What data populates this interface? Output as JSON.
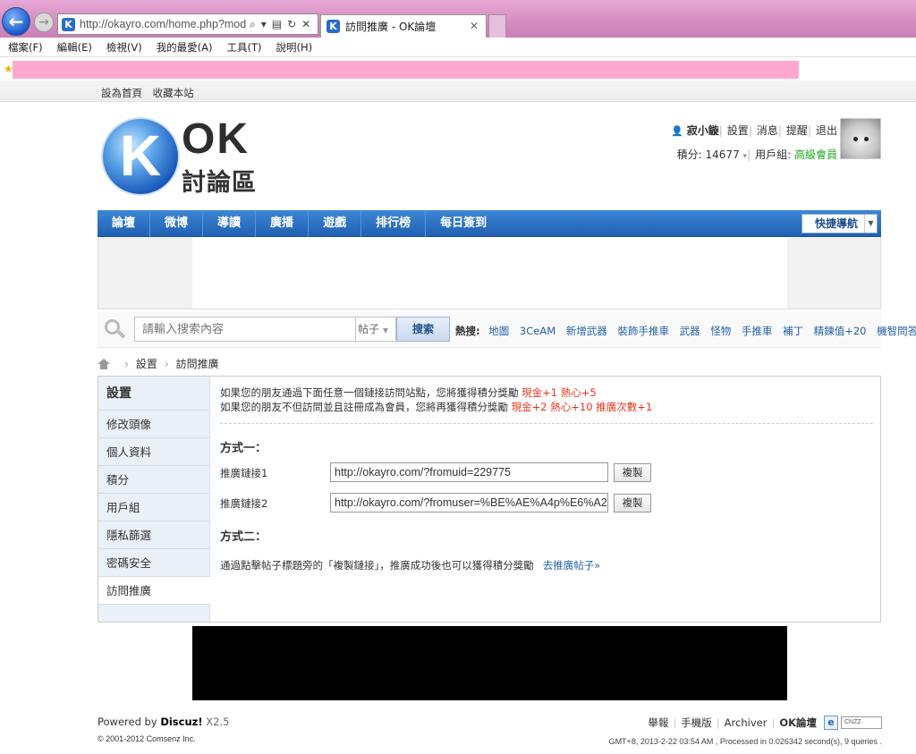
{
  "browser": {
    "url": "http://okayro.com/home.php?mod",
    "tab_title": "訪問推廣 - OK論壇",
    "favicon_letter": "K",
    "menu": [
      "檔案(F)",
      "編輯(E)",
      "檢視(V)",
      "我的最愛(A)",
      "工具(T)",
      "說明(H)"
    ]
  },
  "topbar": {
    "set_home": "設為首頁",
    "bookmark": "收藏本站"
  },
  "logo": {
    "letter": "K",
    "ok": "OK",
    "subtitle": "討論區"
  },
  "user": {
    "name": "寂小鏇",
    "links": [
      "設置",
      "消息",
      "提醒",
      "退出"
    ],
    "credits_label": "積分: 14677",
    "group_label": "用戶組: ",
    "group_value": "高級會員"
  },
  "nav": {
    "items": [
      "論壇",
      "微博",
      "導讀",
      "廣播",
      "遊戲",
      "排行榜",
      "每日簽到"
    ],
    "quick_nav": "快捷導航"
  },
  "search": {
    "placeholder": "請輸入搜索內容",
    "type": "帖子",
    "button": "搜索",
    "hot_label": "熱搜:",
    "hot_words": [
      "地圖",
      "3CeAM",
      "新增武器",
      "裝飾手推車",
      "武器",
      "怪物",
      "手推車",
      "補丁",
      "精鍊值+20",
      "機智問答"
    ]
  },
  "breadcrumb": {
    "settings": "設置",
    "current": "訪問推廣"
  },
  "sidebar": {
    "title": "設置",
    "items": [
      "修改頭像",
      "個人資料",
      "積分",
      "用戶組",
      "隱私篩選",
      "密碼安全",
      "訪問推廣"
    ]
  },
  "content": {
    "tip1": "如果您的朋友通過下面任意一個鏈接訪問站點，您將獲得積分獎勵 ",
    "tip1_reward": "現金+1 熱心+5",
    "tip2": "如果您的朋友不但訪問並且註冊成為會員，您將再獲得積分獎勵 ",
    "tip2_reward": "現金+2 熱心+10 推廣次數+1",
    "method1": "方式一：",
    "link1_label": "推廣鏈接1",
    "link1_value": "http://okayro.com/?fromuid=229775",
    "link2_label": "推廣鏈接2",
    "link2_value": "http://okayro.com/?fromuser=%BE%AE%A4p%E6%A2",
    "copy": "複製",
    "method2": "方式二：",
    "method2_text": "通過點擊帖子標題旁的「複製鏈接」，推廣成功後也可以獲得積分獎勵",
    "goto_post": "去推廣帖子»"
  },
  "footer": {
    "powered_prefix": "Powered by ",
    "powered_name": "Discuz!",
    "powered_version": " X2.5",
    "copyright": "© 2001-2012 Comsenz Inc.",
    "links": [
      "舉報",
      "手機版",
      "Archiver",
      "OK論壇"
    ],
    "cnzz": "CNZZ",
    "server_info": "GMT+8, 2013-2-22 03:54 AM , Processed in 0.026342 second(s), 9 queries ."
  },
  "colors": {
    "nav_blue": "#2a6fc4",
    "reward_red": "#e6331a",
    "link_blue": "#2563a8",
    "group_green": "#1aa81a"
  }
}
